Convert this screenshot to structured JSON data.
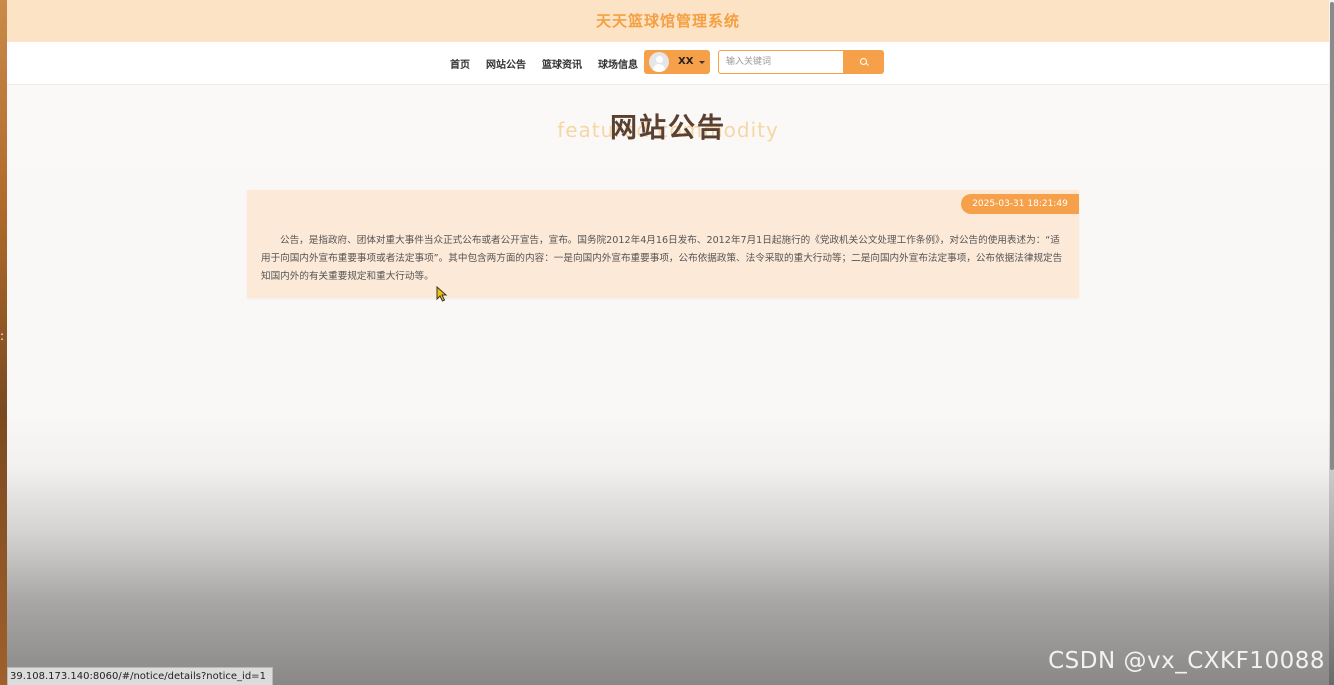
{
  "header": {
    "site_title": "天天篮球馆管理系统"
  },
  "nav": {
    "items": [
      {
        "label": "首页"
      },
      {
        "label": "网站公告"
      },
      {
        "label": "篮球资讯"
      },
      {
        "label": "球场信息"
      }
    ],
    "user": {
      "name": "XX",
      "avatar_icon": "avatar-icon",
      "dropdown_icon": "caret-down-icon"
    },
    "search": {
      "placeholder": "输入关键词",
      "value": "",
      "icon": "search-icon"
    }
  },
  "page": {
    "heading": "网站公告",
    "heading_bg_text": "featured commodity"
  },
  "notice": {
    "date": "2025-03-31 18:21:49",
    "content": "公告，是指政府、团体对重大事件当众正式公布或者公开宣告，宣布。国务院2012年4月16日发布、2012年7月1日起施行的《党政机关公文处理工作条例》，对公告的使用表述为：“适用于向国内外宣布重要事项或者法定事项”。其中包含两方面的内容：一是向国内外宣布重要事项，公布依据政策、法令采取的重大行动等；二是向国内外宣布法定事项，公布依据法律规定告知国内外的有关重要规定和重大行动等。"
  },
  "status_bar": {
    "url": "39.108.173.140:8060/#/notice/details?notice_id=1"
  },
  "watermark": {
    "text": "CSDN @vx_CXKF10088"
  },
  "colors": {
    "accent": "#f7a04a",
    "title_bar_bg": "#fde3c5",
    "card_bg": "#fce9d8",
    "heading": "#5a4030"
  }
}
